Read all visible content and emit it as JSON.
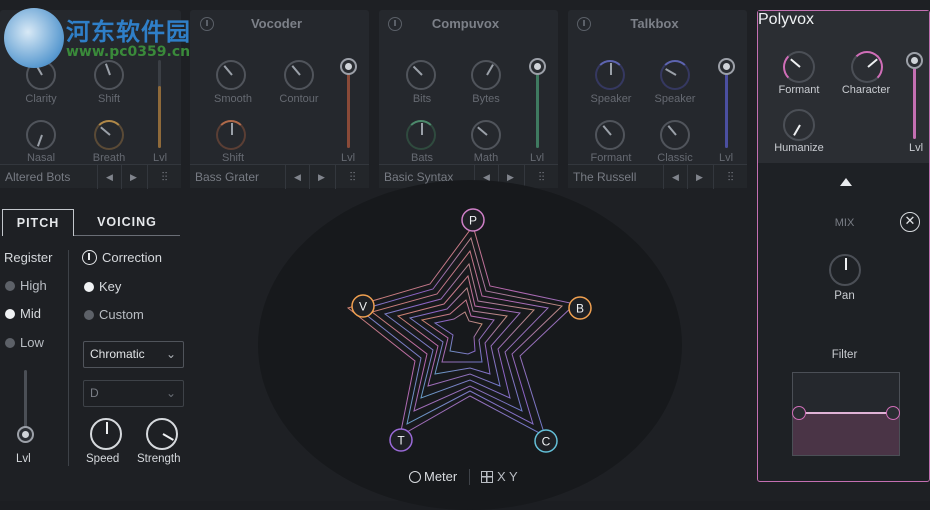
{
  "watermark": {
    "site_name": "河东软件园",
    "url": "www.pc0359.cn"
  },
  "modules": [
    {
      "id": "doubler",
      "title": "",
      "preset": "Altered Bots",
      "knobs": [
        {
          "label": "Clarity"
        },
        {
          "label": "Shift"
        },
        {
          "label": "Nasal"
        },
        {
          "label": "Breath"
        }
      ],
      "fader_label": "Lvl"
    },
    {
      "id": "vocoder",
      "title": "Vocoder",
      "preset": "Bass Grater",
      "knobs": [
        {
          "label": "Smooth"
        },
        {
          "label": "Contour"
        },
        {
          "label": "Shift"
        }
      ],
      "fader_label": "Lvl"
    },
    {
      "id": "compuvox",
      "title": "Compuvox",
      "preset": "Basic Syntax",
      "knobs": [
        {
          "label": "Bits"
        },
        {
          "label": "Bytes"
        },
        {
          "label": "Bats"
        },
        {
          "label": "Math"
        }
      ],
      "fader_label": "Lvl"
    },
    {
      "id": "talkbox",
      "title": "Talkbox",
      "preset": "The Russell",
      "knobs": [
        {
          "label": "Speaker"
        },
        {
          "label": "Speaker"
        },
        {
          "label": "Formant"
        },
        {
          "label": "Classic"
        }
      ],
      "fader_label": "Lvl"
    }
  ],
  "polyvox": {
    "title": "Polyvox",
    "knobs": {
      "formant": "Formant",
      "character": "Character",
      "humanize": "Humanize"
    },
    "fader_label": "Lvl",
    "mix_label": "MIX",
    "pan_label": "Pan",
    "filter_label": "Filter",
    "accent": "#c46fb2"
  },
  "tabs": {
    "pitch": "PITCH",
    "voicing": "VOICING"
  },
  "pitch": {
    "register_label": "Register",
    "register_options": [
      "High",
      "Mid",
      "Low"
    ],
    "register_selected": "Mid",
    "level_label": "Lvl",
    "correction_label": "Correction",
    "correction_options": [
      "Key",
      "Custom"
    ],
    "correction_selected": "Key",
    "scale_value": "Chromatic",
    "key_value": "D",
    "speed_label": "Speed",
    "strength_label": "Strength"
  },
  "visualizer": {
    "nodes": {
      "P": "P",
      "B": "B",
      "C": "C",
      "T": "T",
      "V": "V"
    },
    "meter_label": "Meter",
    "xy_label": "X Y"
  }
}
